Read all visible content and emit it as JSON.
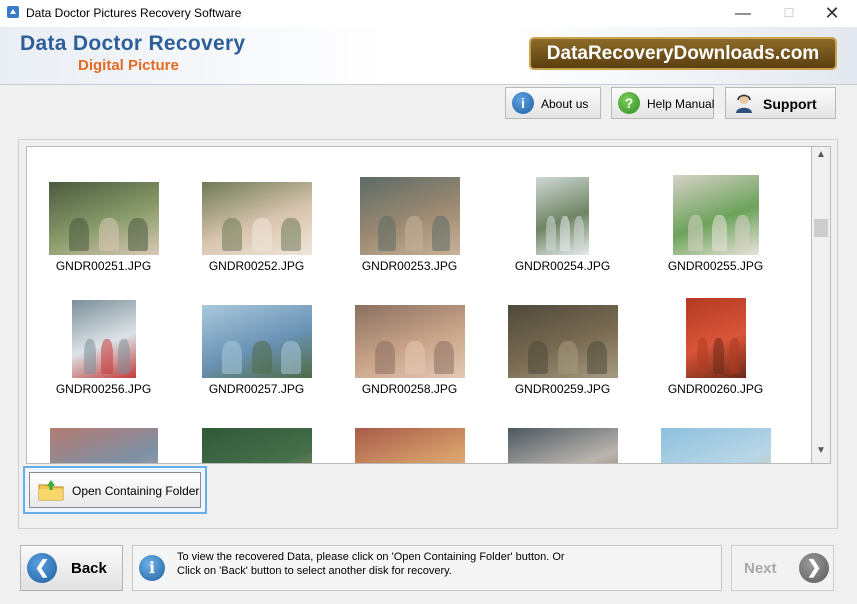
{
  "window": {
    "title": "Data Doctor Pictures Recovery Software",
    "controls": {
      "minimize": "—",
      "maximize": "☐",
      "close": "✕"
    }
  },
  "banner": {
    "line1": "Data Doctor Recovery",
    "line2": "Digital Picture",
    "brand": "DataRecoveryDownloads.com"
  },
  "toolbar": {
    "about_label": "About us",
    "help_label": "Help Manual",
    "support_label": "Support"
  },
  "gallery": {
    "items": [
      {
        "filename": "GNDR00251.JPG",
        "colors": [
          "#4b5a3e",
          "#8a9b6a",
          "#d9c9b6"
        ]
      },
      {
        "filename": "GNDR00252.JPG",
        "colors": [
          "#6e7a58",
          "#d8c4ae",
          "#f0e6da"
        ]
      },
      {
        "filename": "GNDR00253.JPG",
        "colors": [
          "#5d6b66",
          "#9c8a72",
          "#c7b39a"
        ]
      },
      {
        "filename": "GNDR00254.JPG",
        "colors": [
          "#cfd8d6",
          "#6f8463",
          "#e7ecee"
        ]
      },
      {
        "filename": "GNDR00255.JPG",
        "colors": [
          "#d7d1c7",
          "#6ca35b",
          "#e9e3dc"
        ]
      },
      {
        "filename": "GNDR00256.JPG",
        "colors": [
          "#7c8f9a",
          "#dce3e6",
          "#c43a3a"
        ]
      },
      {
        "filename": "GNDR00257.JPG",
        "colors": [
          "#a9c8dc",
          "#6b93b5",
          "#4f6b45"
        ]
      },
      {
        "filename": "GNDR00258.JPG",
        "colors": [
          "#8a7060",
          "#c9a489",
          "#e5c8b4"
        ]
      },
      {
        "filename": "GNDR00259.JPG",
        "colors": [
          "#4e4a3b",
          "#7a6b52",
          "#a69b82"
        ]
      },
      {
        "filename": "GNDR00260.JPG",
        "colors": [
          "#b23a22",
          "#d9553a",
          "#6b2a18"
        ]
      },
      {
        "filename": "",
        "colors": [
          "#b47c72",
          "#7d91a6",
          "#c8b8a8"
        ]
      },
      {
        "filename": "",
        "colors": [
          "#2f5a3a",
          "#466f4a",
          "#c9a080"
        ]
      },
      {
        "filename": "",
        "colors": [
          "#a85b4a",
          "#d69e6a",
          "#e6c489"
        ]
      },
      {
        "filename": "",
        "colors": [
          "#4d5862",
          "#b9b4ad",
          "#7a6a5a"
        ]
      },
      {
        "filename": "",
        "colors": [
          "#8ec0de",
          "#b8d6e6",
          "#d9b489"
        ]
      }
    ]
  },
  "open_folder": {
    "label": "Open Containing Folder"
  },
  "info": {
    "line1": "To view the recovered Data, please click on 'Open Containing Folder' button. Or",
    "line2": "Click on 'Back' button to select another disk for recovery."
  },
  "nav": {
    "back_label": "Back",
    "next_label": "Next"
  },
  "colors": {
    "title_blue": "#2f5f98",
    "subtitle_orange": "#e46b24",
    "brand_gold": "#8c6a28",
    "focus_blue": "#6aaee6"
  }
}
